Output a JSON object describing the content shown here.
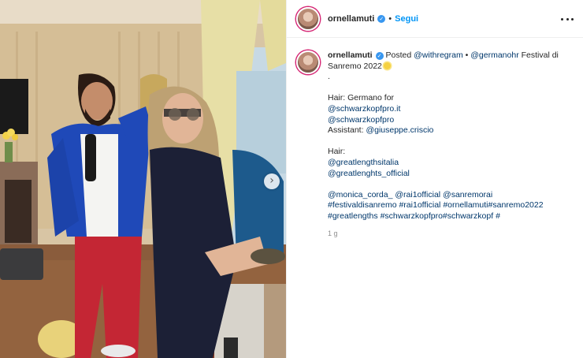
{
  "header": {
    "username": "ornellamuti",
    "separator": "•",
    "follow_label": "Segui"
  },
  "photo": {
    "icon": "chevron-right-icon"
  },
  "caption": {
    "username": "ornellamuti",
    "line1_text": "Posted",
    "line1_link1": "@withregram",
    "line1_sep": "•",
    "line1_link2": "@germanohr",
    "line1_tail": "Festival di",
    "line2_text": "Sanremo 2022",
    "dot_line": ".",
    "hair1_label": "Hair: Germano for",
    "hair1_link1": "@schwarzkopfpro.it",
    "hair1_link2": "@schwarzkopfpro",
    "assistant_label": "Assistant:",
    "assistant_link": "@giuseppe.criscio",
    "hair2_label": "Hair:",
    "hair2_link1": "@greatlengthsitalia",
    "hair2_link2": "@greatlenghts_official",
    "tags_line1a": "@monica_corda_",
    "tags_line1b": "@rai1official",
    "tags_line1c": "@sanremorai",
    "tags_line2a": "#festivaldisanremo",
    "tags_line2b": "#rai1official",
    "tags_line2c": "#ornellamuti#sanremo2022",
    "tags_line3a": "#greatlengths",
    "tags_line3b": "#schwarzkopfpro#schwarzkopf",
    "tags_line3c": "#",
    "time": "1 g"
  },
  "colors": {
    "link": "#00376b",
    "follow": "#0095f6",
    "verified": "#3897f0"
  }
}
